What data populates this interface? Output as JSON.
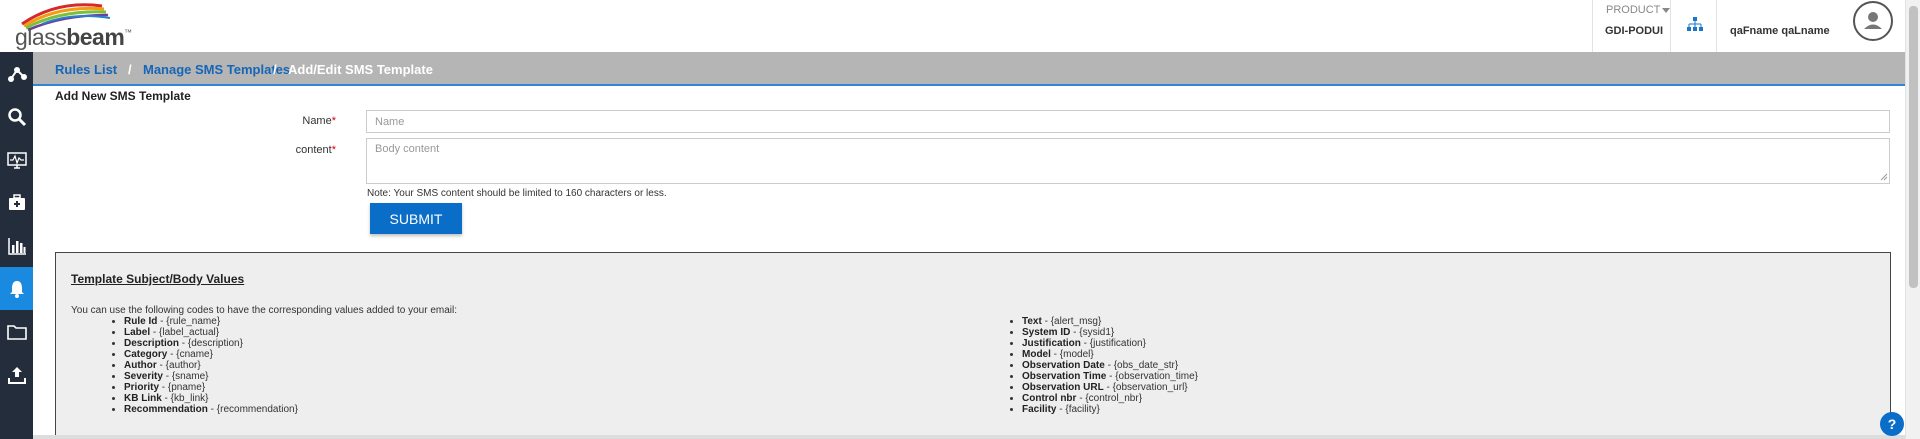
{
  "app": {
    "logo_text_light": "glass",
    "logo_text_bold": "beam",
    "logo_tm": "™"
  },
  "header": {
    "product_label": "PRODUCT",
    "product_value": "GDI-PODUI",
    "user_name": "qaFname qaLname"
  },
  "sidebar": {
    "items": [
      {
        "icon": "network-icon"
      },
      {
        "icon": "search-icon"
      },
      {
        "icon": "monitor-icon"
      },
      {
        "icon": "medical-kit-icon"
      },
      {
        "icon": "bar-chart-icon"
      },
      {
        "icon": "bell-icon",
        "active": true
      },
      {
        "icon": "folder-icon"
      },
      {
        "icon": "upload-icon"
      }
    ]
  },
  "breadcrumb": {
    "items": [
      "Rules List",
      "Manage SMS Templates",
      "Add/Edit SMS Template"
    ],
    "separator": "/"
  },
  "form": {
    "title": "Add New SMS Template",
    "name_label": "Name",
    "name_placeholder": "Name",
    "name_value": "",
    "content_label": "content",
    "content_placeholder": "Body content",
    "content_value": "",
    "required_marker": "*",
    "note": "Note: Your SMS content should be limited to 160 characters or less.",
    "submit_label": "SUBMIT"
  },
  "panel": {
    "title": "Template Subject/Body Values",
    "intro": "You can use the following codes to have the corresponding values added to your email:",
    "left_codes": [
      {
        "name": "Rule Id",
        "code": "{rule_name}"
      },
      {
        "name": "Label",
        "code": "{label_actual}"
      },
      {
        "name": "Description",
        "code": "{description}"
      },
      {
        "name": "Category",
        "code": "{cname}"
      },
      {
        "name": "Author",
        "code": "{author}"
      },
      {
        "name": "Severity",
        "code": "{sname}"
      },
      {
        "name": "Priority",
        "code": "{pname}"
      },
      {
        "name": "KB Link",
        "code": "{kb_link}"
      },
      {
        "name": "Recommendation",
        "code": "{recommendation}"
      }
    ],
    "right_codes": [
      {
        "name": "Text",
        "code": "{alert_msg}"
      },
      {
        "name": "System ID",
        "code": "{sysid1}"
      },
      {
        "name": "Justification",
        "code": "{justification}"
      },
      {
        "name": "Model",
        "code": "{model}"
      },
      {
        "name": "Observation Date",
        "code": "{obs_date_str}"
      },
      {
        "name": "Observation Time",
        "code": "{observation_time}"
      },
      {
        "name": "Observation URL",
        "code": "{observation_url}"
      },
      {
        "name": "Control nbr",
        "code": "{control_nbr}"
      },
      {
        "name": "Facility",
        "code": "{facility}"
      }
    ],
    "dash": " - "
  },
  "help": {
    "label": "?"
  },
  "colors": {
    "sidebar_bg": "#232d3b",
    "sidebar_active": "#1a8ae0",
    "breadcrumb_bg": "#b5b5b5",
    "link": "#1566b7",
    "accent": "#0a6dc8"
  }
}
